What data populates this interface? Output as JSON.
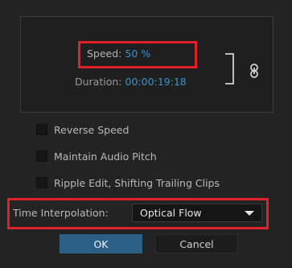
{
  "speed": {
    "label": "Speed:",
    "value": "50",
    "unit": "%"
  },
  "duration": {
    "label": "Duration:",
    "value": "00:00:19:18"
  },
  "checkboxes": [
    {
      "label": "Reverse Speed",
      "checked": false
    },
    {
      "label": "Maintain Audio Pitch",
      "checked": false
    },
    {
      "label": "Ripple Edit, Shifting Trailing Clips",
      "checked": false
    }
  ],
  "interpolation": {
    "label": "Time Interpolation:",
    "selected": "Optical Flow"
  },
  "buttons": {
    "ok": "OK",
    "cancel": "Cancel"
  },
  "colors": {
    "accent": "#2f95d6",
    "highlight": "#e0202b",
    "ok_button": "#2b5f85",
    "background": "#232323"
  },
  "icons": {
    "link": "chain-link-icon",
    "dropdown": "triangle-down-icon"
  }
}
